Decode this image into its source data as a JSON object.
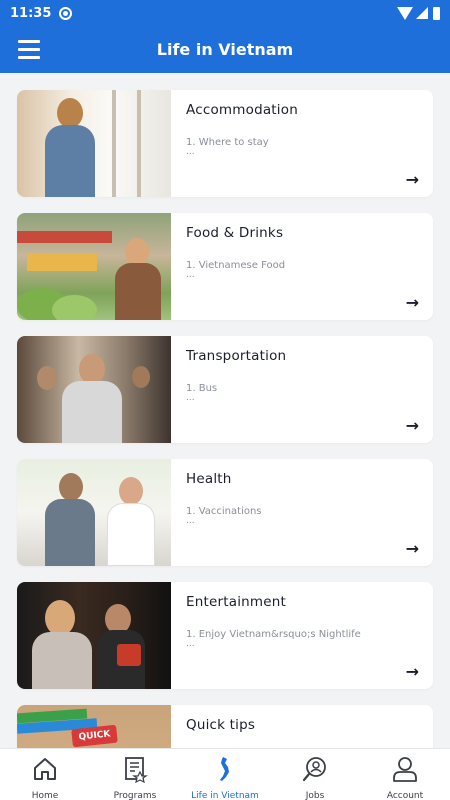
{
  "status": {
    "time": "11:35"
  },
  "header": {
    "title": "Life in Vietnam"
  },
  "cards": [
    {
      "title": "Accommodation",
      "subtitle": "1. Where to stay",
      "ellipsis": "...",
      "arrow": "→"
    },
    {
      "title": "Food & Drinks",
      "subtitle": "1. Vietnamese Food",
      "ellipsis": "...",
      "arrow": "→"
    },
    {
      "title": "Transportation",
      "subtitle": "1. Bus",
      "ellipsis": "...",
      "arrow": "→"
    },
    {
      "title": "Health",
      "subtitle": "1. Vaccinations",
      "ellipsis": "...",
      "arrow": "→"
    },
    {
      "title": "Entertainment",
      "subtitle": "1. Enjoy Vietnam&rsquo;s Nightlife",
      "ellipsis": "...",
      "arrow": "→"
    },
    {
      "title": "Quick tips",
      "image_text": "QUICK"
    }
  ],
  "nav": [
    {
      "label": "Home",
      "icon": "home-icon"
    },
    {
      "label": "Programs",
      "icon": "programs-icon"
    },
    {
      "label": "Life in Vietnam",
      "icon": "vietnam-map-icon",
      "active": true
    },
    {
      "label": "Jobs",
      "icon": "jobs-icon"
    },
    {
      "label": "Account",
      "icon": "account-icon"
    }
  ],
  "colors": {
    "primary": "#1e6fd9",
    "background": "#f2f3f5",
    "active_nav": "#1e6fd9"
  }
}
